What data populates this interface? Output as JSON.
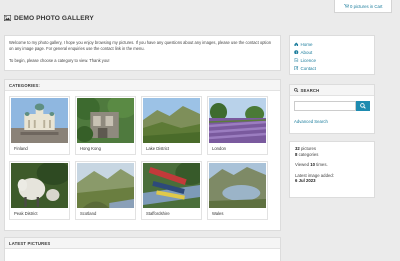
{
  "cart": {
    "label": "0 pictures in Cart",
    "icon": "cart-icon"
  },
  "header": {
    "title": "DEMO PHOTO GALLERY",
    "icon": "gallery-icon"
  },
  "welcome": {
    "line1": "Welcome to my photo gallery, I hope you enjoy browsing my pictures. If you have any questions about any images, please use the contact option on any image page. For general enquiries use the contact link in the menu.",
    "line2": "To begin, please choose a category to view. Thank you!"
  },
  "categories": {
    "heading": "CATEGORIES:",
    "items": [
      {
        "label": "Finland"
      },
      {
        "label": "Hong Kong"
      },
      {
        "label": "Lake District"
      },
      {
        "label": "London"
      },
      {
        "label": "Peak District"
      },
      {
        "label": "Scotland"
      },
      {
        "label": "Staffordshire"
      },
      {
        "label": "Wales"
      }
    ]
  },
  "latest": {
    "heading": "LATEST PICTURES"
  },
  "nav": {
    "items": [
      {
        "label": "Home",
        "icon": "home-icon"
      },
      {
        "label": "About",
        "icon": "info-icon"
      },
      {
        "label": "Licence",
        "icon": "document-icon"
      },
      {
        "label": "Contact",
        "icon": "edit-icon"
      }
    ]
  },
  "search": {
    "heading": "SEARCH",
    "placeholder": "",
    "advanced": "Advanced Search"
  },
  "stats": {
    "pictures_count": "32",
    "pictures_label": "pictures",
    "categories_count": "8",
    "categories_label": "categories",
    "viewed_prefix": "Viewed",
    "viewed_count": "10",
    "viewed_suffix": "times.",
    "latest_label": "Latest image added:",
    "latest_date": "6 Jul 2023"
  },
  "colors": {
    "accent": "#1a7c9c",
    "button": "#1e8bb0",
    "background": "#ebebeb"
  }
}
